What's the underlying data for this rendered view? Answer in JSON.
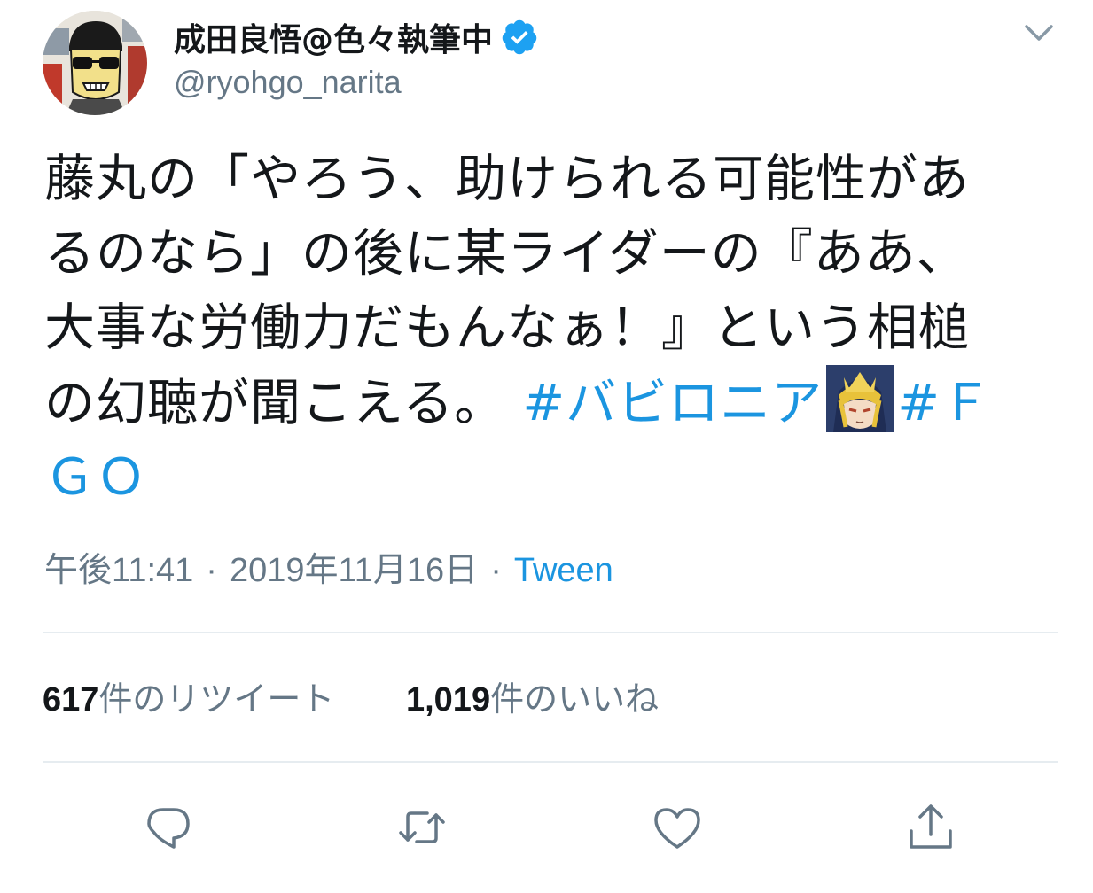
{
  "author": {
    "display_name": "成田良悟@色々執筆中",
    "handle": "@ryohgo_narita",
    "verified_icon": "verified-badge-icon",
    "avatar_icon": "avatar"
  },
  "tweet": {
    "lines": [
      "藤丸の「やろう、助けられる可能性があ",
      "るのなら」の後に某ライダーの『ああ、",
      "大事な労働力だもんなぁ！』という相槌",
      "の幻聴が聞こえる。"
    ],
    "hashtag_1": "#バビロニア",
    "hashtag_2_part1": "#Ｆ",
    "hashtag_2_part2": "ＧＯ",
    "emoji_icon": "gilgamesh-face-emoji"
  },
  "meta": {
    "time": "午後11:41",
    "date": "2019年11月16日",
    "client": "Tween",
    "separator": "·"
  },
  "stats": {
    "retweet_count": "617",
    "retweet_label": "件のリツイート",
    "like_count": "1,019",
    "like_label": "件のいいね"
  },
  "actions": {
    "icons": [
      "reply-icon",
      "retweet-icon",
      "like-icon",
      "share-icon"
    ]
  },
  "colors": {
    "link": "#1b95e0",
    "secondary": "#657786",
    "divider": "#e6ecf0",
    "primary_text": "#14171a"
  }
}
